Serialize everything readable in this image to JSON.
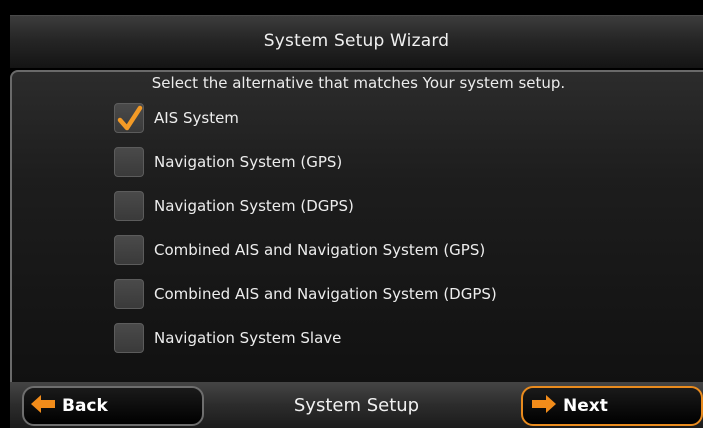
{
  "header": {
    "title": "System Setup Wizard"
  },
  "instruction": "Select the alternative that matches Your system setup.",
  "options": [
    {
      "label": "AIS System",
      "checked": true
    },
    {
      "label": "Navigation System (GPS)",
      "checked": false
    },
    {
      "label": "Navigation System (DGPS)",
      "checked": false
    },
    {
      "label": "Combined AIS and Navigation System (GPS)",
      "checked": false
    },
    {
      "label": "Combined AIS and Navigation System (DGPS)",
      "checked": false
    },
    {
      "label": "Navigation System Slave",
      "checked": false
    }
  ],
  "footer": {
    "back_label": "Back",
    "center_label": "System Setup",
    "next_label": "Next"
  },
  "colors": {
    "accent": "#f28c1a",
    "checkmark": "#f39a26"
  },
  "icons": {
    "back": "left-arrow-icon",
    "next": "right-arrow-icon",
    "check": "checkmark-icon"
  }
}
